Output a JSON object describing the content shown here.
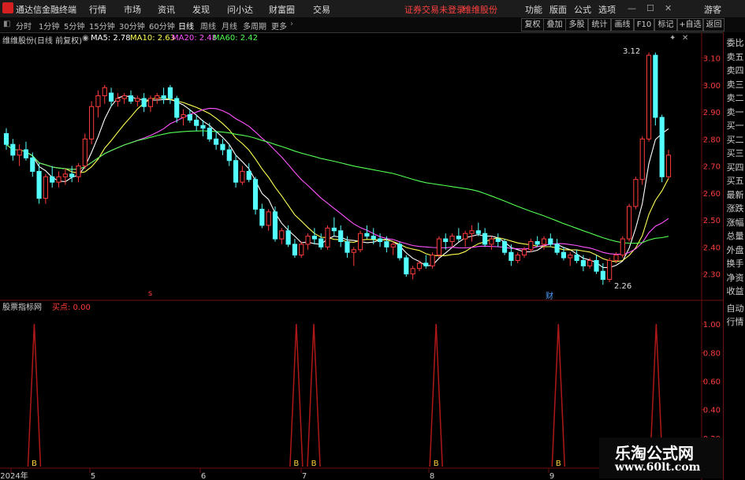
{
  "titlebar": {
    "app_title": "通达信金融终端",
    "menus": [
      "行情",
      "市场",
      "资讯",
      "发现",
      "问小达",
      "财富圈",
      "交易"
    ],
    "broker_notice": "证券交易未登录",
    "stock_name_top": "维维股份",
    "right_menus": [
      "功能",
      "版面",
      "公式",
      "选项"
    ],
    "guest": "游客"
  },
  "periodbar": {
    "periods": [
      "分时",
      "1分钟",
      "5分钟",
      "15分钟",
      "30分钟",
      "60分钟",
      "日线",
      "周线",
      "月线",
      "多周期",
      "更多"
    ],
    "active_period": "日线",
    "buttons": [
      "复权",
      "叠加",
      "多股",
      "统计",
      "画线",
      "F10",
      "标记",
      "+自选",
      "返回"
    ]
  },
  "chart_header": {
    "stock": "维维股份(日线 前复权)",
    "ma5": "MA5: 2.78",
    "ma10": "MA10: 2.63",
    "ma20": "MA20: 2.48",
    "ma60": "MA60: 2.42"
  },
  "indicator_header": {
    "name": "股票指标网",
    "value": "买点: 0.00"
  },
  "side_panel": [
    "委比",
    "卖五",
    "卖四",
    "卖三",
    "卖二",
    "卖一",
    "买一",
    "买二",
    "买三",
    "买四",
    "买五",
    "最新",
    "涨跌",
    "涨幅",
    "总量",
    "外盘",
    "换手",
    "净资",
    "收益"
  ],
  "side_panel_bottom": [
    "自动",
    "行情"
  ],
  "price_axis": [
    "3.10",
    "3.00",
    "2.90",
    "2.80",
    "2.70",
    "2.60",
    "2.50",
    "2.40",
    "2.30"
  ],
  "ind_axis": [
    "1.00",
    "0.80",
    "0.60",
    "0.40",
    "0.20"
  ],
  "date_axis": [
    "2024年",
    "5",
    "6",
    "7",
    "8",
    "9"
  ],
  "annotations": {
    "high": "3.12",
    "low": "2.26",
    "marker_red": "s",
    "marker_blue": "财"
  },
  "buy_label": "B",
  "watermark": {
    "line1": "乐淘公式网",
    "line2": "www.60lt.com"
  },
  "colors": {
    "up": "#ff3c3c",
    "down": "#54ffff",
    "ma5": "#ffffff",
    "ma10": "#ffff54",
    "ma20": "#ff54ff",
    "ma60": "#54ff54",
    "grid": "#6b1010"
  },
  "chart_data": [
    {
      "type": "candlestick",
      "title": "维维股份(日线 前复权)",
      "ylim": [
        2.22,
        3.16
      ],
      "ohlc": [
        [
          2.82,
          2.84,
          2.76,
          2.78
        ],
        [
          2.78,
          2.8,
          2.72,
          2.74
        ],
        [
          2.74,
          2.78,
          2.7,
          2.76
        ],
        [
          2.76,
          2.79,
          2.72,
          2.73
        ],
        [
          2.73,
          2.75,
          2.66,
          2.68
        ],
        [
          2.68,
          2.71,
          2.56,
          2.58
        ],
        [
          2.58,
          2.67,
          2.56,
          2.66
        ],
        [
          2.66,
          2.7,
          2.62,
          2.64
        ],
        [
          2.64,
          2.68,
          2.62,
          2.66
        ],
        [
          2.66,
          2.69,
          2.63,
          2.67
        ],
        [
          2.67,
          2.7,
          2.64,
          2.66
        ],
        [
          2.66,
          2.71,
          2.64,
          2.7
        ],
        [
          2.7,
          2.82,
          2.69,
          2.8
        ],
        [
          2.8,
          2.94,
          2.78,
          2.92
        ],
        [
          2.92,
          2.98,
          2.88,
          2.96
        ],
        [
          2.96,
          3.0,
          2.93,
          2.99
        ],
        [
          2.97,
          2.99,
          2.92,
          2.94
        ],
        [
          2.94,
          2.97,
          2.92,
          2.95
        ],
        [
          2.95,
          2.97,
          2.93,
          2.96
        ],
        [
          2.96,
          2.98,
          2.93,
          2.94
        ],
        [
          2.94,
          2.96,
          2.92,
          2.95
        ],
        [
          2.95,
          2.97,
          2.9,
          2.92
        ],
        [
          2.92,
          2.96,
          2.9,
          2.95
        ],
        [
          2.95,
          2.97,
          2.93,
          2.96
        ],
        [
          2.96,
          2.99,
          2.93,
          2.95
        ],
        [
          2.99,
          3.0,
          2.93,
          2.95
        ],
        [
          2.95,
          2.96,
          2.86,
          2.88
        ],
        [
          2.88,
          2.91,
          2.85,
          2.89
        ],
        [
          2.89,
          2.91,
          2.86,
          2.87
        ],
        [
          2.87,
          2.89,
          2.83,
          2.85
        ],
        [
          2.85,
          2.87,
          2.81,
          2.84
        ],
        [
          2.84,
          2.86,
          2.79,
          2.8
        ],
        [
          2.8,
          2.83,
          2.76,
          2.78
        ],
        [
          2.78,
          2.8,
          2.74,
          2.76
        ],
        [
          2.76,
          2.78,
          2.7,
          2.72
        ],
        [
          2.72,
          2.74,
          2.62,
          2.64
        ],
        [
          2.64,
          2.7,
          2.63,
          2.68
        ],
        [
          2.68,
          2.71,
          2.64,
          2.65
        ],
        [
          2.65,
          2.66,
          2.52,
          2.54
        ],
        [
          2.54,
          2.56,
          2.47,
          2.48
        ],
        [
          2.48,
          2.54,
          2.46,
          2.53
        ],
        [
          2.53,
          2.55,
          2.42,
          2.43
        ],
        [
          2.43,
          2.47,
          2.41,
          2.46
        ],
        [
          2.46,
          2.48,
          2.4,
          2.41
        ],
        [
          2.41,
          2.43,
          2.36,
          2.37
        ],
        [
          2.37,
          2.42,
          2.36,
          2.41
        ],
        [
          2.41,
          2.45,
          2.39,
          2.44
        ],
        [
          2.44,
          2.47,
          2.41,
          2.43
        ],
        [
          2.43,
          2.45,
          2.39,
          2.4
        ],
        [
          2.4,
          2.48,
          2.39,
          2.47
        ],
        [
          2.47,
          2.51,
          2.44,
          2.46
        ],
        [
          2.46,
          2.48,
          2.4,
          2.42
        ],
        [
          2.42,
          2.44,
          2.36,
          2.38
        ],
        [
          2.38,
          2.4,
          2.33,
          2.39
        ],
        [
          2.39,
          2.46,
          2.38,
          2.45
        ],
        [
          2.45,
          2.48,
          2.43,
          2.44
        ],
        [
          2.44,
          2.47,
          2.41,
          2.43
        ],
        [
          2.43,
          2.45,
          2.4,
          2.42
        ],
        [
          2.42,
          2.44,
          2.38,
          2.4
        ],
        [
          2.4,
          2.42,
          2.37,
          2.41
        ],
        [
          2.41,
          2.42,
          2.35,
          2.36
        ],
        [
          2.36,
          2.37,
          2.29,
          2.3
        ],
        [
          2.3,
          2.33,
          2.28,
          2.32
        ],
        [
          2.32,
          2.35,
          2.31,
          2.34
        ],
        [
          2.34,
          2.37,
          2.32,
          2.33
        ],
        [
          2.33,
          2.38,
          2.32,
          2.37
        ],
        [
          2.37,
          2.44,
          2.36,
          2.43
        ],
        [
          2.43,
          2.45,
          2.39,
          2.42
        ],
        [
          2.42,
          2.45,
          2.4,
          2.44
        ],
        [
          2.44,
          2.47,
          2.42,
          2.43
        ],
        [
          2.43,
          2.46,
          2.4,
          2.45
        ],
        [
          2.45,
          2.48,
          2.42,
          2.46
        ],
        [
          2.46,
          2.49,
          2.44,
          2.45
        ],
        [
          2.45,
          2.47,
          2.4,
          2.41
        ],
        [
          2.41,
          2.44,
          2.39,
          2.43
        ],
        [
          2.43,
          2.45,
          2.4,
          2.42
        ],
        [
          2.42,
          2.43,
          2.37,
          2.38
        ],
        [
          2.38,
          2.41,
          2.33,
          2.35
        ],
        [
          2.35,
          2.38,
          2.34,
          2.37
        ],
        [
          2.37,
          2.4,
          2.36,
          2.39
        ],
        [
          2.39,
          2.43,
          2.38,
          2.42
        ],
        [
          2.42,
          2.44,
          2.4,
          2.41
        ],
        [
          2.41,
          2.44,
          2.39,
          2.43
        ],
        [
          2.43,
          2.45,
          2.4,
          2.41
        ],
        [
          2.41,
          2.43,
          2.37,
          2.38
        ],
        [
          2.38,
          2.4,
          2.35,
          2.36
        ],
        [
          2.36,
          2.38,
          2.33,
          2.37
        ],
        [
          2.37,
          2.39,
          2.34,
          2.35
        ],
        [
          2.35,
          2.37,
          2.31,
          2.33
        ],
        [
          2.33,
          2.36,
          2.32,
          2.35
        ],
        [
          2.35,
          2.37,
          2.3,
          2.31
        ],
        [
          2.31,
          2.34,
          2.26,
          2.28
        ],
        [
          2.28,
          2.36,
          2.27,
          2.35
        ],
        [
          2.35,
          2.38,
          2.34,
          2.37
        ],
        [
          2.37,
          2.44,
          2.36,
          2.43
        ],
        [
          2.43,
          2.56,
          2.42,
          2.55
        ],
        [
          2.55,
          2.66,
          2.54,
          2.65
        ],
        [
          2.65,
          2.81,
          2.63,
          2.8
        ],
        [
          2.8,
          3.12,
          2.79,
          3.11
        ],
        [
          3.11,
          3.12,
          2.85,
          2.88
        ],
        [
          2.88,
          2.89,
          2.64,
          2.66
        ],
        [
          2.66,
          2.76,
          2.65,
          2.74
        ]
      ]
    },
    {
      "type": "bar",
      "title": "股票指标网",
      "ylim": [
        0,
        1.1
      ],
      "signal_indices": [
        8,
        83,
        88,
        123,
        158,
        186
      ],
      "signal_value": 1.0
    }
  ]
}
